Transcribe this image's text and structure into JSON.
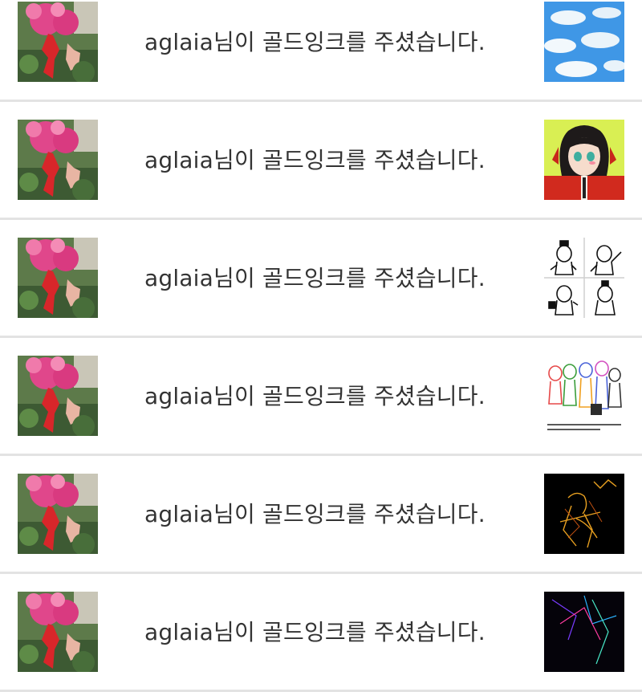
{
  "notifications": [
    {
      "message": "aglaia님이 골드잉크를 주셨습니다.",
      "avatar_icon": "flower-photo-avatar",
      "thumb_icon": "sky-clouds-thumbnail"
    },
    {
      "message": "aglaia님이 골드잉크를 주셨습니다.",
      "avatar_icon": "flower-photo-avatar",
      "thumb_icon": "anime-girl-thumbnail"
    },
    {
      "message": "aglaia님이 골드잉크를 주셨습니다.",
      "avatar_icon": "flower-photo-avatar",
      "thumb_icon": "sketch-comic-thumbnail"
    },
    {
      "message": "aglaia님이 골드잉크를 주셨습니다.",
      "avatar_icon": "flower-photo-avatar",
      "thumb_icon": "doodle-characters-thumbnail"
    },
    {
      "message": "aglaia님이 골드잉크를 주셨습니다.",
      "avatar_icon": "flower-photo-avatar",
      "thumb_icon": "dark-neon-sketch-thumbnail"
    },
    {
      "message": "aglaia님이 골드잉크를 주셨습니다.",
      "avatar_icon": "flower-photo-avatar",
      "thumb_icon": "dark-neon-lines-thumbnail"
    }
  ]
}
